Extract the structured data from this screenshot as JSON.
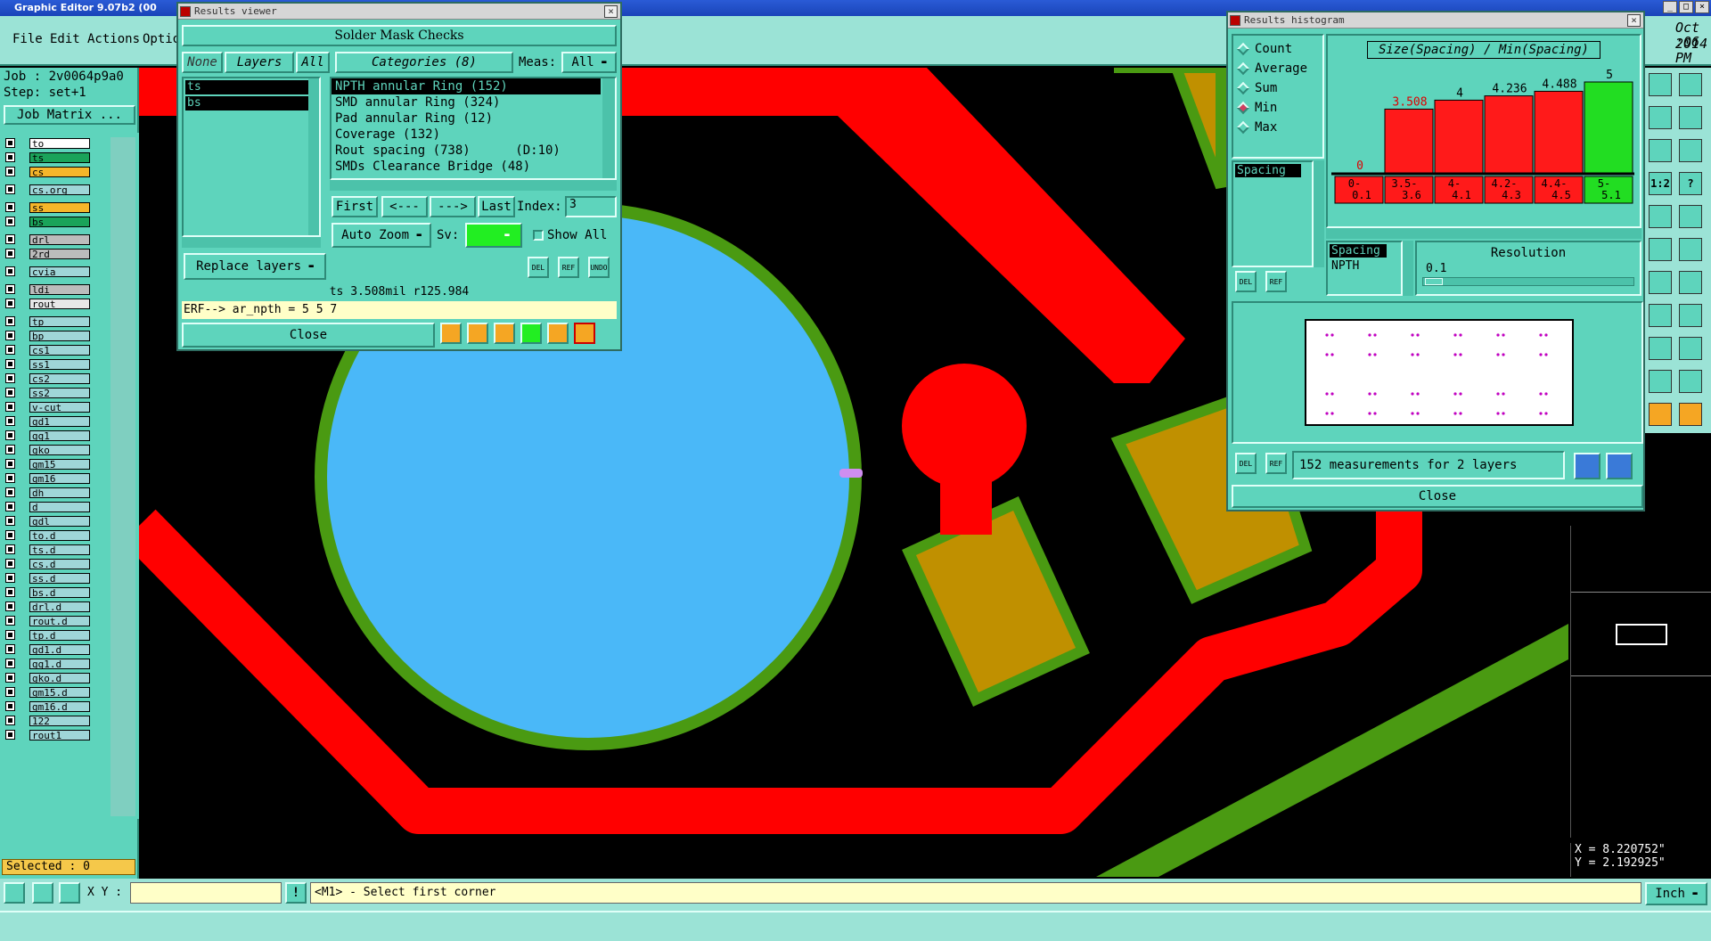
{
  "app": {
    "title": "Graphic Editor 9.07b2 (00",
    "menu": [
      "File",
      "Edit",
      "Actions",
      "Optio"
    ],
    "clock": [
      "Oct 2014",
      ":06 PM"
    ]
  },
  "job": {
    "job_label": "Job : 2v0064p9a0",
    "step_label": "Step: set+1",
    "matrix_button": "Job Matrix ..."
  },
  "layers": [
    {
      "name": "to",
      "color": "#ffffff"
    },
    {
      "name": "ts",
      "color": "#1aa35a"
    },
    {
      "name": "cs",
      "color": "#f5b62a"
    },
    {
      "name": "cs.org",
      "color": "#9fd6d8"
    },
    {
      "name": "ss",
      "color": "#f5b62a"
    },
    {
      "name": "bs",
      "color": "#1aa35a"
    },
    {
      "name": "drl",
      "color": "#bcbcbc"
    },
    {
      "name": "2rd",
      "color": "#bcbcbc"
    },
    {
      "name": "cvia",
      "color": "#9fd6d8"
    },
    {
      "name": "ldi",
      "color": "#bcbcbc"
    },
    {
      "name": "rout",
      "color": "#e8e8e8"
    },
    {
      "name": "tp",
      "color": "#9fd6d8"
    },
    {
      "name": "bp",
      "color": "#9fd6d8"
    },
    {
      "name": "cs1",
      "color": "#9fd6d8"
    },
    {
      "name": "ss1",
      "color": "#9fd6d8"
    },
    {
      "name": "cs2",
      "color": "#9fd6d8"
    },
    {
      "name": "ss2",
      "color": "#9fd6d8"
    },
    {
      "name": "v-cut",
      "color": "#9fd6d8"
    },
    {
      "name": "gd1",
      "color": "#9fd6d8"
    },
    {
      "name": "gg1",
      "color": "#9fd6d8"
    },
    {
      "name": "gko",
      "color": "#9fd6d8"
    },
    {
      "name": "gm15",
      "color": "#9fd6d8"
    },
    {
      "name": "gm16",
      "color": "#9fd6d8"
    },
    {
      "name": "dh",
      "color": "#9fd6d8"
    },
    {
      "name": "d",
      "color": "#9fd6d8"
    },
    {
      "name": "gdl",
      "color": "#9fd6d8"
    },
    {
      "name": "to.d",
      "color": "#9fd6d8"
    },
    {
      "name": "ts.d",
      "color": "#9fd6d8"
    },
    {
      "name": "cs.d",
      "color": "#9fd6d8"
    },
    {
      "name": "ss.d",
      "color": "#9fd6d8"
    },
    {
      "name": "bs.d",
      "color": "#9fd6d8"
    },
    {
      "name": "drl.d",
      "color": "#9fd6d8"
    },
    {
      "name": "rout.d",
      "color": "#9fd6d8"
    },
    {
      "name": "tp.d",
      "color": "#9fd6d8"
    },
    {
      "name": "gd1.d",
      "color": "#9fd6d8"
    },
    {
      "name": "gg1.d",
      "color": "#9fd6d8"
    },
    {
      "name": "gko.d",
      "color": "#9fd6d8"
    },
    {
      "name": "gm15.d",
      "color": "#9fd6d8"
    },
    {
      "name": "gm16.d",
      "color": "#9fd6d8"
    },
    {
      "name": "122",
      "color": "#9fd6d8"
    },
    {
      "name": "rout1",
      "color": "#9fd6d8"
    }
  ],
  "selected_label": "Selected : 0",
  "results_viewer": {
    "title": "Results viewer",
    "header": "Solder Mask Checks",
    "none_btn": "None",
    "layers_btn": "Layers",
    "all_btn": "All",
    "categories_btn": "Categories (8)",
    "meas_label": "Meas:",
    "meas_value": "All",
    "layer_list": [
      "ts",
      "bs"
    ],
    "categories": [
      "NPTH annular Ring (152)",
      "SMD annular Ring (324)",
      "Pad annular Ring (12)",
      "Coverage (132)",
      "Rout spacing (738)      (D:10)",
      "SMDs Clearance Bridge (48)"
    ],
    "first_btn": "First",
    "prev_btn": "<---",
    "next_btn": "--->",
    "last_btn": "Last",
    "index_label": "Index:",
    "index_value": "3",
    "auto_zoom": "Auto Zoom",
    "sv_label": "Sv:",
    "show_all": "Show All",
    "replace_layers": "Replace layers",
    "small_btns": [
      "DEL",
      "REF",
      "UNDO"
    ],
    "status": "ts 3.508mil  r125.984",
    "erf": "ERF--> ar_npth = 5 5 7",
    "close": "Close"
  },
  "histogram": {
    "title": "Results histogram",
    "modes": [
      "Count",
      "Average",
      "Sum",
      "Min",
      "Max"
    ],
    "selected_mode": "Min",
    "list_item": "Spacing",
    "chart_title": "Size(Spacing) / Min(Spacing)",
    "resolution_label": "Resolution",
    "resolution_value": "0.1",
    "cols": [
      "Spacing",
      "NPTH"
    ],
    "del_btn": "DEL",
    "ref_btn": "REF",
    "measurements": "152 measurements for 2 layers",
    "close": "Close"
  },
  "chart_data": {
    "type": "bar",
    "title": "Size(Spacing) / Min(Spacing)",
    "categories": [
      "0-\n0.1",
      "3.5-\n3.6",
      "4-\n4.1",
      "4.2-\n4.3",
      "4.4-\n4.5",
      "5-\n5.1"
    ],
    "values": [
      0,
      3.508,
      4,
      4.236,
      4.488,
      5
    ],
    "value_labels": [
      "0",
      "3.508",
      "4",
      "4.236",
      "4.488",
      "5"
    ],
    "colors": [
      "#ff1a1a",
      "#ff1a1a",
      "#ff1a1a",
      "#ff1a1a",
      "#ff1a1a",
      "#22dd22"
    ],
    "ylim": [
      0,
      5
    ]
  },
  "coords": {
    "x": "X = 8.220752\"",
    "y": "Y = 2.192925\""
  },
  "bottom": {
    "xy_label": "X Y :",
    "prompt": "<M1> - Select first corner",
    "units": "Inch"
  },
  "right_tools": [
    "1:2",
    "?"
  ]
}
